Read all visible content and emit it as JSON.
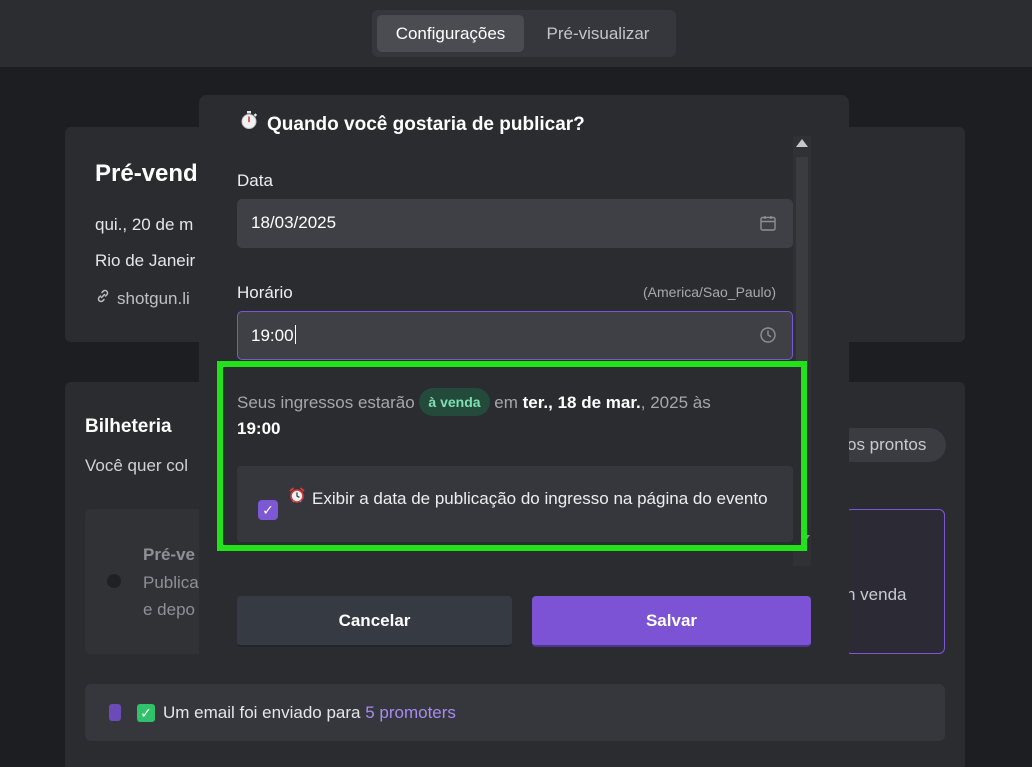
{
  "tabs": {
    "settings": "Configurações",
    "preview": "Pré-visualizar"
  },
  "background": {
    "event_title": "Pré-vend",
    "event_date": "qui., 20 de m",
    "event_city": "Rio de Janeir",
    "event_link": "shotgun.li",
    "box_title": "Bilheteria",
    "box_subtitle": "Você quer col",
    "ready_pill": "os prontos",
    "option_left_title": "Pré-ve",
    "option_left_line2": "Publica",
    "option_left_line3": "e depo",
    "option_right_text": "n venda",
    "notice_text": "Um email foi enviado para ",
    "notice_highlight": "5 promoters"
  },
  "modal": {
    "title": "Quando você gostaria de publicar?",
    "title_icon": "stopwatch-icon",
    "date_label": "Data",
    "date_value": "18/03/2025",
    "time_label": "Horário",
    "timezone": "(America/Sao_Paulo)",
    "time_value": "19:00",
    "summary_prefix": "Seus ingressos estarão",
    "summary_badge": "à venda",
    "summary_mid": "em",
    "summary_date": "ter., 18 de mar.",
    "summary_year": ", 2025 às",
    "summary_time": "19:00",
    "checkbox_text": "Exibir a data de publicação do ingresso na página do evento",
    "checkbox_icon": "alarm-clock-icon",
    "checkbox_checked": true,
    "cancel_label": "Cancelar",
    "save_label": "Salvar"
  },
  "colors": {
    "accent": "#7b53d4",
    "highlight_border": "#22e21c",
    "badge_bg": "#244a3c",
    "badge_text": "#7fe0b1"
  }
}
